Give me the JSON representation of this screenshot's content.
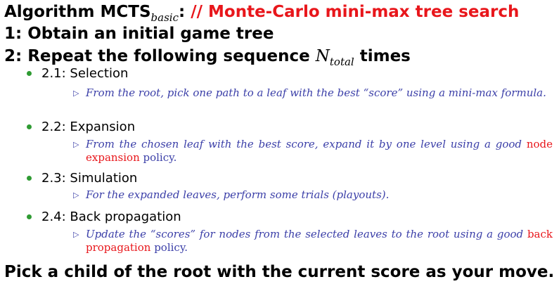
{
  "header": {
    "algorithm_label": "Algorithm MCTS",
    "algorithm_subscript": "basic",
    "colon": ":",
    "comment": "// Monte-Carlo mini-max tree search"
  },
  "steps": [
    {
      "label": "1: Obtain an initial game tree"
    },
    {
      "prefix": "2: Repeat the following sequence ",
      "var": "N",
      "var_sub": "total",
      "suffix": " times"
    }
  ],
  "substeps": [
    {
      "title": "2.1: Selection",
      "text_a": "From the root, pick one path to a leaf with the best “score” using a mini-max formula.",
      "text_highlight": "",
      "text_b": ""
    },
    {
      "title": "2.2: Expansion",
      "text_a": "From the chosen leaf with the best score, expand it by one level using a good ",
      "text_highlight": "node expansion",
      "text_b": " policy."
    },
    {
      "title": "2.3: Simulation",
      "text_a": "For the expanded leaves, perform some trials (playouts).",
      "text_highlight": "",
      "text_b": ""
    },
    {
      "title": "2.4: Back propagation",
      "text_a": "Update the “scores” for nodes from the selected leaves to the root using a good ",
      "text_highlight": "back propagation",
      "text_b": " policy."
    }
  ],
  "final": "Pick a child of the root with the current score as your move.",
  "bullet_marker": "▷",
  "colors": {
    "comment": "#e8161b",
    "detail": "#3b3fa8",
    "bullet": "#2f9b33"
  }
}
